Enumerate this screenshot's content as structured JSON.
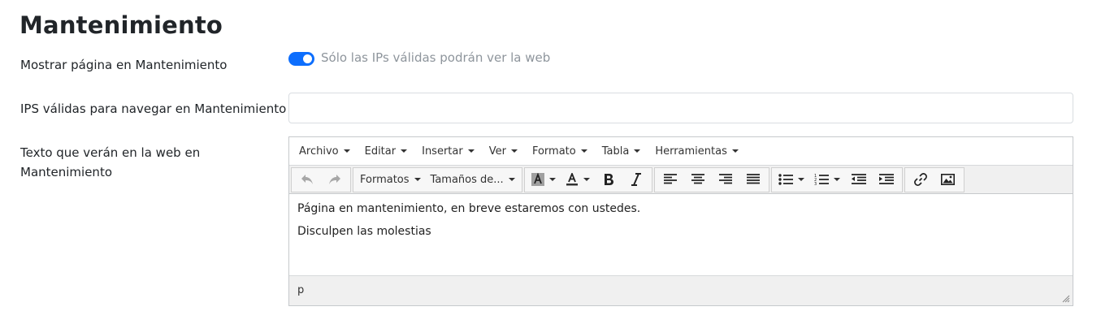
{
  "page_title": "Mantenimiento",
  "fields": {
    "show_maintenance": {
      "label": "Mostrar página en Mantenimiento",
      "toggle_on": true,
      "hint": "Sólo las IPs válidas podrán ver la web"
    },
    "valid_ips": {
      "label": "IPS válidas para navegar en Mantenimiento",
      "value": "",
      "placeholder": ""
    },
    "message_text": {
      "label_line1": "Texto que verán en la web en",
      "label_line2": "Mantenimiento"
    }
  },
  "editor": {
    "menu": [
      "Archivo",
      "Editar",
      "Insertar",
      "Ver",
      "Formato",
      "Tabla",
      "Herramientas"
    ],
    "formats_label": "Formatos",
    "sizes_label": "Tamaños de...",
    "content": [
      "Página en mantenimiento, en breve estaremos con ustedes.",
      "Disculpen las molestias"
    ],
    "status_path": "p"
  },
  "colors": {
    "accent": "#0d6efd",
    "hint_text": "#8e959c",
    "toolbar_bg": "#f0f0f0"
  },
  "icons": [
    "undo-icon",
    "redo-icon",
    "background-color-icon",
    "text-color-icon",
    "bold-icon",
    "italic-icon",
    "align-left-icon",
    "align-center-icon",
    "align-right-icon",
    "align-justify-icon",
    "bullet-list-icon",
    "numbered-list-icon",
    "outdent-icon",
    "indent-icon",
    "link-icon",
    "image-icon",
    "resize-handle-icon"
  ]
}
